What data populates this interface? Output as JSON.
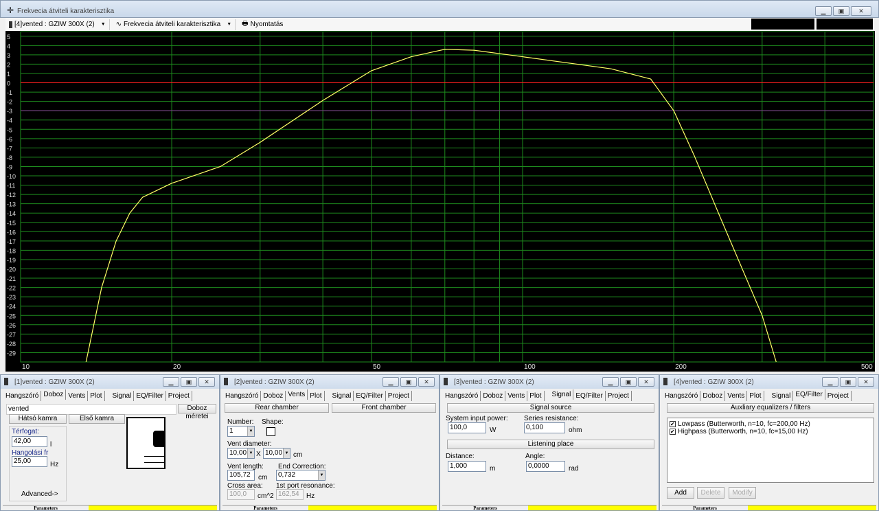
{
  "window": {
    "title": "Frekvecia átviteli karakterisztika",
    "icon": "crosshair-icon"
  },
  "toolbar": {
    "project": "[4]vented : GZIW 300X (2)",
    "plot": "Frekvecia átviteli karakterisztika",
    "print": "Nyomtatás"
  },
  "chart_data": {
    "type": "line",
    "xscale": "log",
    "xlim": [
      10,
      500
    ],
    "ylim": [
      -30,
      5.5
    ],
    "xticks": [
      10,
      20,
      50,
      100,
      200,
      500
    ],
    "yticks": [
      5,
      4,
      3,
      2,
      1,
      0,
      -1,
      -2,
      -3,
      -4,
      -5,
      -6,
      -7,
      -8,
      -9,
      -10,
      -11,
      -12,
      -13,
      -14,
      -15,
      -16,
      -17,
      -18,
      -19,
      -20,
      -21,
      -22,
      -23,
      -24,
      -25,
      -26,
      -27,
      -28,
      -29
    ],
    "grid": true,
    "background": "#000000",
    "grid_color": "#1e8c1e",
    "line_color": "#ffff66",
    "reference_lines": [
      {
        "y": 0,
        "color": "#ff2020"
      },
      {
        "y": -3,
        "color": "#8a3a9a"
      }
    ],
    "x": [
      13.5,
      14.5,
      15.5,
      16.5,
      17.5,
      20,
      25,
      30,
      40,
      50,
      60,
      70,
      80,
      100,
      150,
      180,
      200,
      220,
      250,
      300,
      320
    ],
    "y": [
      -30,
      -22,
      -17,
      -14,
      -12.3,
      -10.8,
      -9,
      -6.4,
      -1.9,
      1.3,
      2.8,
      3.6,
      3.5,
      2.8,
      1.5,
      0.4,
      -3,
      -7.9,
      -15,
      -25,
      -30
    ]
  },
  "panels": [
    {
      "title": "[1]vented :  GZIW 300X (2)",
      "tabs": [
        "Hangszóró",
        "Doboz",
        "Vents",
        "Plot",
        "Signal",
        "EQ/Filter",
        "Project"
      ],
      "selected": 1,
      "name": "vented",
      "size_btn": "Doboz méretei",
      "rear": "Hátsó kamra",
      "front": "Első kamra",
      "volume_label": "Térfogat:",
      "volume": "42,00",
      "volume_unit": "l",
      "tune_label": "Hangolási fr",
      "tune": "25,00",
      "tune_unit": "Hz",
      "advanced": "Advanced->",
      "footer": "Parameters"
    },
    {
      "title": "[2]vented :  GZIW 300X (2)",
      "tabs": [
        "Hangszóró",
        "Doboz",
        "Vents",
        "Plot",
        "Signal",
        "EQ/Filter",
        "Project"
      ],
      "selected": 2,
      "rear": "Rear chamber",
      "front": "Front chamber",
      "number_label": "Number:",
      "number": "1",
      "shape_label": "Shape:",
      "diam_label": "Vent diameter:",
      "diam1": "10,00",
      "diam2": "10,00",
      "diam_unit": "cm",
      "times": "X",
      "len_label": "Vent length:",
      "len": "105,72",
      "len_unit": "cm",
      "endc_label": "End Correction:",
      "endc": "0,732",
      "area_label": "Cross area:",
      "area": "100,0",
      "area_unit": "cm^2",
      "res_label": "1st port resonance:",
      "res": "162,54",
      "res_unit": "Hz",
      "footer": "Parameters"
    },
    {
      "title": "[3]vented :  GZIW 300X (2)",
      "tabs": [
        "Hangszóró",
        "Doboz",
        "Vents",
        "Plot",
        "Signal",
        "EQ/Filter",
        "Project"
      ],
      "selected": 4,
      "source": "Signal source",
      "power_label": "System input power:",
      "power": "100,0",
      "power_unit": "W",
      "res_label": "Series resistance:",
      "res": "0,100",
      "res_unit": "ohm",
      "listen": "Listening place",
      "dist_label": "Distance:",
      "dist": "1,000",
      "dist_unit": "m",
      "angle_label": "Angle:",
      "angle": "0,0000",
      "angle_unit": "rad",
      "footer": "Parameters"
    },
    {
      "title": "[4]vented :  GZIW 300X (2)",
      "tabs": [
        "Hangszóró",
        "Doboz",
        "Vents",
        "Plot",
        "Signal",
        "EQ/Filter",
        "Project"
      ],
      "selected": 5,
      "header": "Auxliary equalizers / filters",
      "filters": [
        {
          "label": "Lowpass (Butterworth, n=10, fc=200,00 Hz)",
          "checked": true
        },
        {
          "label": "Highpass (Butterworth, n=10, fc=15,00 Hz)",
          "checked": true
        }
      ],
      "add": "Add",
      "delete": "Delete",
      "modify": "Modify",
      "footer": "Parameters"
    }
  ]
}
